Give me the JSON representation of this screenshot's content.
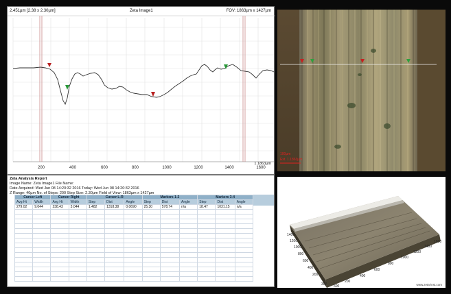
{
  "profile": {
    "header_left": "2.451µm [2.38 x 2.30µm]",
    "header_center": "Zeta Image1",
    "header_right": "FOV: 1863µm x 1427µm",
    "corner_note": "1.1863µm",
    "x_ticks": [
      "200",
      "400",
      "600",
      "800",
      "1000",
      "1200",
      "1400",
      "1600"
    ]
  },
  "report": {
    "title": "Zeta Analysis Report",
    "line1": "Image Name: Zeta Image1  File Name:",
    "line2": "Date Acquired:    Wed Jun 08 14:20:32 2016  Today: Wed Jun 08 14:20:32 2016",
    "line3": "Z Range:     40µm No. of Steps: 200   Step Size:    2.30µm     Field of View: 1863µm x 1427µm",
    "groups": [
      "Cursor Left",
      "Cursor Right",
      "Cursor L-R",
      "Markers 1-2",
      "Markers 3-4"
    ],
    "columns": [
      "Avg Ht",
      "Width",
      "Avg Ht",
      "Width",
      "Step",
      "Dist",
      "Angle",
      "Step",
      "Dist",
      "Angle",
      "Step",
      "Dist",
      "Angle"
    ],
    "values": [
      "279.02",
      "9.044",
      "238.43",
      "3.044",
      "1.482",
      "1318.38",
      "0.0690",
      "25.30",
      "578.74",
      "n/a",
      "18.47",
      "1031.15",
      "n/a"
    ]
  },
  "micro": {
    "scale_label": "100µm",
    "scale_sub": "Ext. 1.1863µm"
  },
  "view3d": {
    "y_ticks": [
      "1400",
      "1200",
      "1000",
      "800",
      "600",
      "400",
      "200"
    ],
    "x_ticks": [
      "200",
      "400",
      "600",
      "800",
      "1000",
      "1200",
      "1400",
      "1600"
    ],
    "z_ticks": [
      "300",
      "600"
    ],
    "watermark": "www.zeta-inst.com"
  }
}
